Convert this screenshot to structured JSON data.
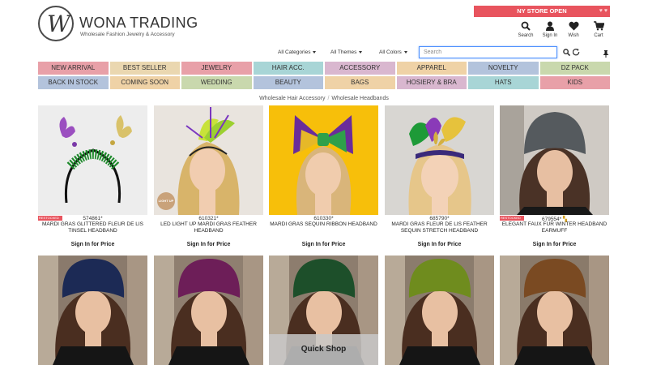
{
  "brand": {
    "name": "WONA TRADING",
    "tagline": "Wholesale Fashion Jewelry & Accessory",
    "logo_letter": "W"
  },
  "store_banner": "NY STORE OPEN",
  "header_icons": [
    {
      "label": "Search",
      "icon": "search-icon"
    },
    {
      "label": "Sign In",
      "icon": "user-icon"
    },
    {
      "label": "Wish",
      "icon": "heart-icon"
    },
    {
      "label": "Cart",
      "icon": "cart-icon"
    }
  ],
  "filters": {
    "categories": "All Categories",
    "themes": "All Themes",
    "colors": "All Colors"
  },
  "search": {
    "placeholder": "Search",
    "value": ""
  },
  "nav": [
    {
      "label": "NEW ARRIVAL",
      "color": "#e8a0a8"
    },
    {
      "label": "BEST SELLER",
      "color": "#ead7b0"
    },
    {
      "label": "JEWELRY",
      "color": "#e8a0a8"
    },
    {
      "label": "HAIR ACC.",
      "color": "#a8d5d6"
    },
    {
      "label": "ACCESSORY",
      "color": "#d9b7cf"
    },
    {
      "label": "APPAREL",
      "color": "#efd2a6"
    },
    {
      "label": "NOVELTY",
      "color": "#b3c3dc"
    },
    {
      "label": "DZ PACK",
      "color": "#c9d8ad"
    },
    {
      "label": "BACK IN STOCK",
      "color": "#b3c3dc"
    },
    {
      "label": "COMING SOON",
      "color": "#efd2a6"
    },
    {
      "label": "WEDDING",
      "color": "#c9d8ad"
    },
    {
      "label": "BEAUTY",
      "color": "#b3c3dc"
    },
    {
      "label": "BAGS",
      "color": "#efd2a6"
    },
    {
      "label": "HOSIERY & BRA",
      "color": "#d9b7cf"
    },
    {
      "label": "HATS",
      "color": "#a8d5d6"
    },
    {
      "label": "KIDS",
      "color": "#e8a0a8"
    }
  ],
  "breadcrumb": [
    "Wholesale Hair Accessory",
    "Wholesale Headbands"
  ],
  "products": [
    {
      "sku": "574861*",
      "name": "MARDI GRAS GLITTERED FLEUR DE LIS TINSEL HEADBAND",
      "price": "Sign In for Price",
      "badge": "RESTOCKED",
      "bg": "#ededed"
    },
    {
      "sku": "610321*",
      "name": "LED LIGHT UP MARDI GRAS FEATHER HEADBAND",
      "price": "Sign In for Price",
      "badge": "",
      "bg": "#e9e4de",
      "overlay": "LIGHT UP"
    },
    {
      "sku": "610330*",
      "name": "MARDI GRAS SEQUIN RIBBON HEADBAND",
      "price": "Sign In for Price",
      "badge": "",
      "bg": "#f7bf0a"
    },
    {
      "sku": "685790*",
      "name": "MARDI GRAS FLEUR DE LIS FEATHER SEQUIN STRETCH HEADBAND",
      "price": "Sign In for Price",
      "badge": "",
      "bg": "#d8d6d2"
    },
    {
      "sku": "679554*",
      "name": "ELEGANT FAUX FUR WINTER HEADBAND EARMUFF",
      "price": "Sign In for Price",
      "badge": "RESTOCKED",
      "bg": "#cfcac4"
    },
    {
      "bg": "#8a7a6c",
      "fur": "#1c2a55"
    },
    {
      "bg": "#8f7f70",
      "fur": "#6d1e58"
    },
    {
      "bg": "#8d7d6e",
      "fur": "#1d4f2a",
      "quick_shop": "Quick Shop"
    },
    {
      "bg": "#8b7c6d",
      "fur": "#6f8c1e"
    },
    {
      "bg": "#8a7a6a",
      "fur": "#7a4a22"
    }
  ]
}
